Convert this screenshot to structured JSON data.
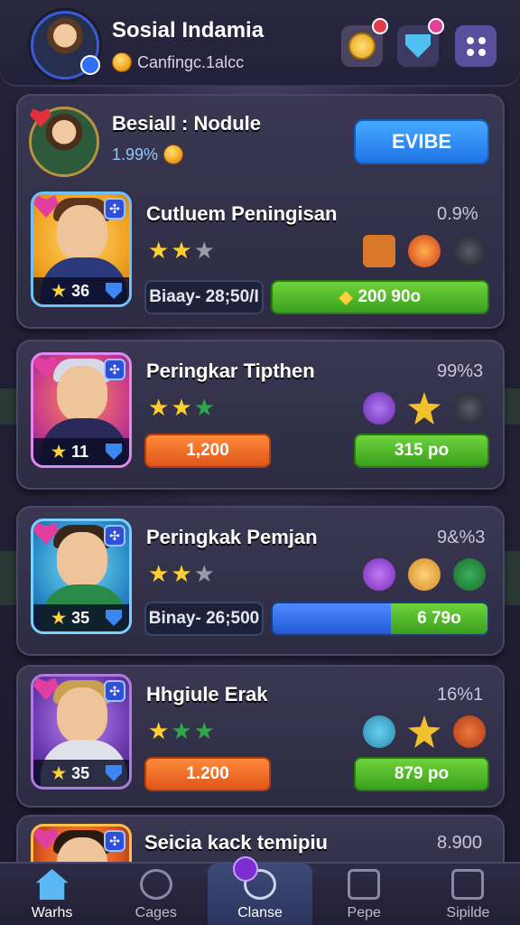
{
  "header": {
    "title": "Sosial Indamia",
    "subtitle": "Canfingc.1alcc"
  },
  "featured": {
    "title": "Besiall : Nodule",
    "value": "1.99%",
    "button_label": "EVIBE"
  },
  "cards": [
    {
      "title": "Cutluem Peningisan",
      "percent": "0.9%",
      "level": "36",
      "stars": [
        "on",
        "on",
        "off"
      ],
      "left_pill": "Biaay- 28;50/I",
      "right_pill": "200 90o"
    },
    {
      "title": "Peringkar Tipthen",
      "percent": "99%3",
      "level": "11",
      "stars": [
        "on",
        "on",
        "green"
      ],
      "left_pill": "1,200",
      "right_pill": "315 po"
    },
    {
      "title": "Peringkak Pemjan",
      "percent": "9&%3",
      "level": "35",
      "stars": [
        "on",
        "on",
        "off"
      ],
      "left_pill": "Binay- 26;500",
      "right_pill": "6 79o",
      "progress_fraction": 0.55
    },
    {
      "title": "Hhgiule Erak",
      "percent": "16%1",
      "level": "35",
      "stars": [
        "on",
        "green",
        "green"
      ],
      "left_pill": "1.200",
      "right_pill": "879 po"
    },
    {
      "title": "Seicia kack temipiu",
      "percent": "8.900"
    }
  ],
  "nav": [
    "Warhs",
    "Cages",
    "Clanse",
    "Pepe",
    "Sipilde"
  ]
}
